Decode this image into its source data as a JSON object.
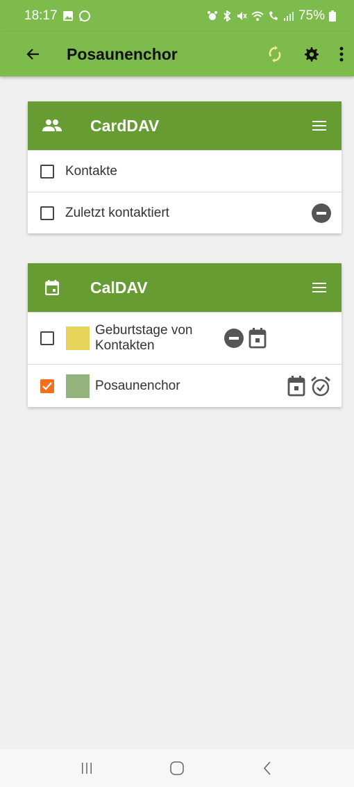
{
  "status": {
    "time": "18:17",
    "battery": "75%"
  },
  "appbar": {
    "title": "Posaunenchor"
  },
  "carddav": {
    "title": "CardDAV",
    "items": [
      {
        "label": "Kontakte",
        "checked": false
      },
      {
        "label": "Zuletzt kontaktiert",
        "checked": false
      }
    ]
  },
  "caldav": {
    "title": "CalDAV",
    "items": [
      {
        "label": "Geburtstage von Kontakten",
        "checked": false,
        "color": "#e6d35a"
      },
      {
        "label": "Posaunenchor",
        "checked": true,
        "color": "#94b27c"
      }
    ]
  },
  "colors": {
    "appbar": "#7cbb4c",
    "card_header": "#679c33",
    "checkbox_checked": "#f26f1b"
  }
}
